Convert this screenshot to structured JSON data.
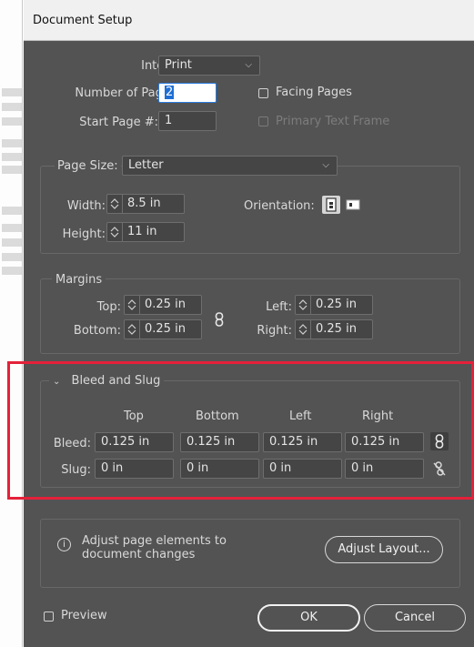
{
  "window": {
    "title": "Document Setup"
  },
  "intent": {
    "label": "Intent:",
    "value": "Print"
  },
  "pages": {
    "number_label": "Number of Pages:",
    "number_value": "2",
    "start_label": "Start Page #:",
    "start_value": "1",
    "facing_pages_label": "Facing Pages",
    "primary_text_frame_label": "Primary Text Frame"
  },
  "page_size": {
    "label": "Page Size:",
    "value": "Letter",
    "width_label": "Width:",
    "width_value": "8.5 in",
    "height_label": "Height:",
    "height_value": "11 in",
    "orientation_label": "Orientation:"
  },
  "margins": {
    "title": "Margins",
    "top_label": "Top:",
    "top_value": "0.25 in",
    "bottom_label": "Bottom:",
    "bottom_value": "0.25 in",
    "left_label": "Left:",
    "left_value": "0.25 in",
    "right_label": "Right:",
    "right_value": "0.25 in"
  },
  "bleed_slug": {
    "title": "Bleed and Slug",
    "columns": [
      "Top",
      "Bottom",
      "Left",
      "Right"
    ],
    "bleed_label": "Bleed:",
    "bleed_values": [
      "0.125 in",
      "0.125 in",
      "0.125 in",
      "0.125 in"
    ],
    "slug_label": "Slug:",
    "slug_values": [
      "0 in",
      "0 in",
      "0 in",
      "0 in"
    ]
  },
  "adjust": {
    "message": "Adjust page elements to document changes",
    "button_label": "Adjust Layout..."
  },
  "footer": {
    "preview_label": "Preview",
    "ok_label": "OK",
    "cancel_label": "Cancel"
  },
  "colors": {
    "dialog_bg": "#535353",
    "highlight": "#e4213a",
    "focus_blue": "#2a7be0"
  }
}
